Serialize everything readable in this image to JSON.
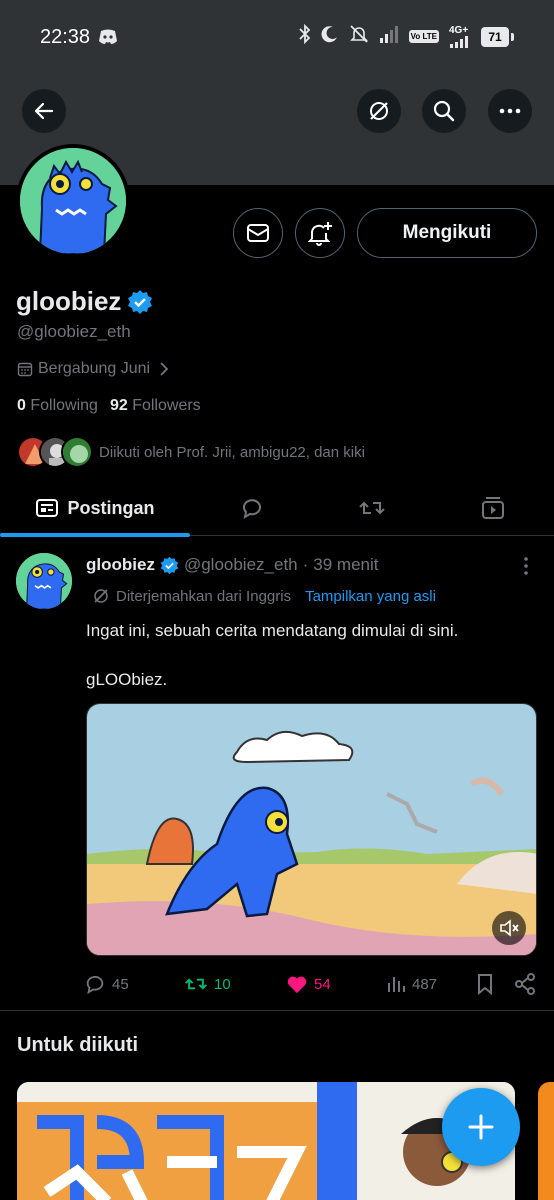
{
  "status_bar": {
    "time": "22:38",
    "battery": "71",
    "network": "4G+",
    "volte": "Vo LTE"
  },
  "profile": {
    "display_name": "gloobiez",
    "handle": "@gloobiez_eth",
    "joined": "Bergabung Juni",
    "following_count": "0",
    "following_label": "Following",
    "followers_count": "92",
    "followers_label": "Followers",
    "followed_by": "Diikuti oleh Prof. Jrii, ambigu22, dan kiki",
    "follow_button": "Mengikuti"
  },
  "tabs": {
    "posts_label": "Postingan"
  },
  "post": {
    "name": "gloobiez",
    "handle": "@gloobiez_eth",
    "separator": "·",
    "time": "39 menit",
    "translated_label": "Diterjemahkan dari Inggris",
    "show_original": "Tampilkan yang asli",
    "text_line1": "Ingat ini, sebuah cerita mendatang dimulai di sini.",
    "text_line2": "gLOObiez.",
    "replies": "45",
    "reposts": "10",
    "likes": "54",
    "views": "487"
  },
  "suggestions": {
    "title": "Untuk diikuti"
  },
  "colors": {
    "accent": "#1d9bf0",
    "repost": "#00ba7c",
    "like": "#f91880",
    "muted_text": "#71767b",
    "verified": "#1d9bf0"
  }
}
